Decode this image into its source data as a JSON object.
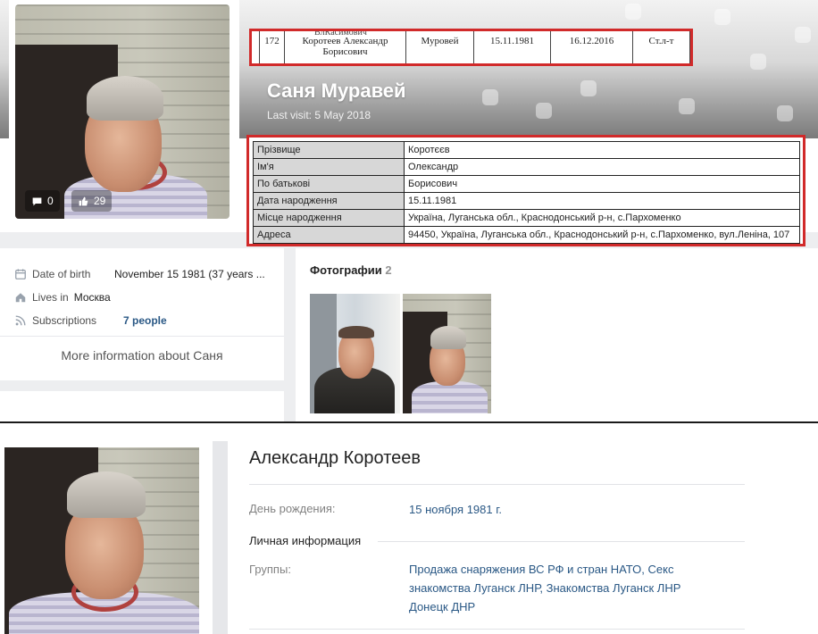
{
  "profile": {
    "name": "Саня Муравей",
    "last_visit": "Last visit: 5 May 2018",
    "stats": {
      "comments": "0",
      "likes": "29"
    },
    "info": {
      "birth_label": "Date of birth",
      "birth_value": "November 15 1981 (37 years ...",
      "city_label": "Lives in",
      "city_value": "Москва",
      "subs_label": "Subscriptions",
      "subs_value": "7 people"
    },
    "more_info": "More information about Саня",
    "photos_title": "Фотографии",
    "photos_count": "2"
  },
  "registry": {
    "header_fragment": "ВлКасимович",
    "row": {
      "num": "172",
      "full_name_line1": "Коротеев Александр",
      "full_name_line2": "Борисович",
      "nickname": "Муровей",
      "birth": "15.11.1981",
      "date": "16.12.2016",
      "article": "Ст.л-т"
    }
  },
  "record": {
    "rows": [
      {
        "key": "Прізвище",
        "value": "Коротєєв"
      },
      {
        "key": "Ім'я",
        "value": "Олександр"
      },
      {
        "key": "По батькові",
        "value": "Борисович"
      },
      {
        "key": "Дата народження",
        "value": "15.11.1981"
      },
      {
        "key": "Місце народження",
        "value": "Україна, Луганська обл., Краснодонський р-н, с.Пархоменко"
      },
      {
        "key": "Адреса",
        "value": "94450, Україна, Луганська обл., Краснодонський р-н, с.Пархоменко, вул.Леніна, 107"
      }
    ]
  },
  "second_profile": {
    "name": "Александр Коротеев",
    "birthday_label": "День рождения:",
    "birthday_value": "15 ноября 1981 г.",
    "section_personal": "Личная информация",
    "groups_label": "Группы:",
    "groups_line1": "Продажа снаряжения ВС РФ и стран НАТО, Секс",
    "groups_line2": "знакомства Луганск ЛНР, Знакомства Луганск ЛНР",
    "groups_line3": "Донецк ДНР"
  },
  "colors": {
    "highlight": "#d12a2a",
    "link": "#2a5885",
    "vk_bg": "#edeef0"
  }
}
